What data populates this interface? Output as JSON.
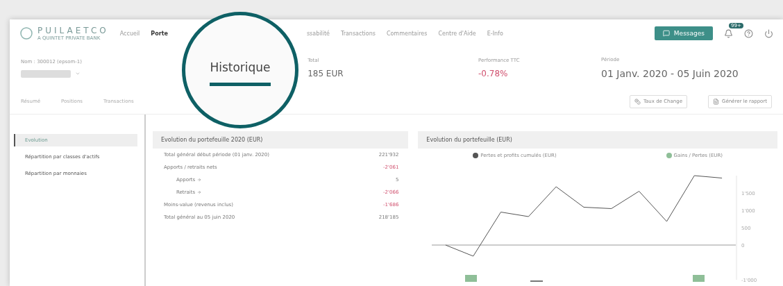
{
  "logo": {
    "name": "PUILAETCO",
    "tagline": "A QUINTET PRIVATE BANK"
  },
  "nav": [
    {
      "label": "Accueil",
      "selected": false
    },
    {
      "label": "Porte",
      "selected": true
    },
    {
      "label": "ssabilité",
      "selected": false
    },
    {
      "label": "Transactions",
      "selected": false
    },
    {
      "label": "Commentaires",
      "selected": false
    },
    {
      "label": "Centre d'Aide",
      "selected": false
    },
    {
      "label": "E-Info",
      "selected": false
    }
  ],
  "messages_button": "Messages",
  "notification_badge": "99+",
  "account": {
    "label": "Nom : 300012 (epsom-1)"
  },
  "summary": [
    {
      "label": "Total",
      "value": "185 EUR",
      "kind": "amount"
    },
    {
      "label": "Performance TTC",
      "value": "-0.78%",
      "kind": "negative"
    },
    {
      "label": "Période",
      "value": "01 Janv. 2020 - 05 Juin 2020",
      "kind": "period"
    }
  ],
  "subtabs": [
    {
      "label": "Résumé",
      "selected": false
    },
    {
      "label": "Positions",
      "selected": false
    },
    {
      "label": "Transactions",
      "selected": false
    }
  ],
  "magnified_tab": {
    "label": "Historique",
    "selected": true
  },
  "actions": [
    {
      "label": "Taux de Change",
      "kind": "exchange"
    },
    {
      "label": "Générer le rapport",
      "kind": "report"
    }
  ],
  "sidebar": [
    {
      "label": "Evolution",
      "selected": true
    },
    {
      "label": "Répartition par classes d'actifs",
      "selected": false
    },
    {
      "label": "Répartition par monnaies",
      "selected": false
    }
  ],
  "table": {
    "title": "Evolution du portefeuille 2020 (EUR)",
    "rows": [
      {
        "label": "Total général début période (01 janv. 2020)",
        "value": "221'932",
        "negative": false,
        "indent": false
      },
      {
        "label": "Apports / retraits nets",
        "value": "-2'061",
        "negative": true,
        "indent": false
      },
      {
        "label": "Apports",
        "value": "5",
        "negative": false,
        "indent": true
      },
      {
        "label": "Retraits",
        "value": "-2'066",
        "negative": true,
        "indent": true
      },
      {
        "label": "Moins-value (revenus inclus)",
        "value": "-1'686",
        "negative": true,
        "indent": false
      },
      {
        "label": "Total général au 05 juin 2020",
        "value": "218'185",
        "negative": false,
        "indent": false
      }
    ]
  },
  "chart": {
    "title": "Evolution du portefeuille (EUR)",
    "legend": [
      {
        "label": "Gains / Pertes (EUR)",
        "color": "#8fbf98"
      }
    ],
    "chart_data": {
      "type": "line",
      "ylim": [
        -1000,
        2000
      ],
      "series": [
        {
          "name": "Pertes et profits cumulés (EUR)",
          "color": "#555555",
          "values": [
            0,
            -320,
            950,
            820,
            1680,
            1090,
            1050,
            1550,
            680,
            2000,
            1930
          ]
        }
      ],
      "yticks": [
        {
          "value": 1500,
          "label": "1'500"
        },
        {
          "value": 1000,
          "label": "1'000"
        },
        {
          "value": 500,
          "label": "500"
        },
        {
          "value": 0,
          "label": "0"
        },
        {
          "value": -1000,
          "label": "-1'000"
        }
      ]
    }
  }
}
